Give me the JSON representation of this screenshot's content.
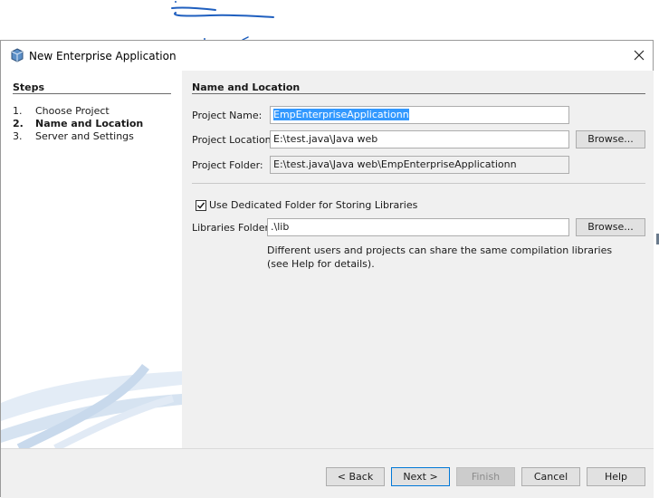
{
  "window": {
    "title": "New Enterprise Application"
  },
  "steps": {
    "title": "Steps",
    "items": [
      {
        "num": "1.",
        "label": "Choose Project"
      },
      {
        "num": "2.",
        "label": "Name and Location"
      },
      {
        "num": "3.",
        "label": "Server and Settings"
      }
    ]
  },
  "section": {
    "title": "Name and Location"
  },
  "form": {
    "project_name_label": "Project Name:",
    "project_name_value": "EmpEnterpriseApplicationn",
    "project_location_label": "Project Location:",
    "project_location_value": "E:\\test.java\\Java web",
    "project_folder_label": "Project Folder:",
    "project_folder_value": "E:\\test.java\\Java web\\EmpEnterpriseApplicationn",
    "browse_label": "Browse...",
    "dedicated_folder_label": "Use Dedicated Folder for Storing Libraries",
    "dedicated_folder_checked": true,
    "libraries_folder_label": "Libraries Folder:",
    "libraries_folder_value": ".\\lib",
    "note_line1": "Different users and projects can share the same compilation libraries",
    "note_line2": "(see Help for details)."
  },
  "buttons": {
    "back": "< Back",
    "next": "Next >",
    "finish": "Finish",
    "cancel": "Cancel",
    "help": "Help"
  },
  "colors": {
    "selection": "#3399ff",
    "panel": "#f0f0f0",
    "scribble": "#1f5fbf"
  }
}
